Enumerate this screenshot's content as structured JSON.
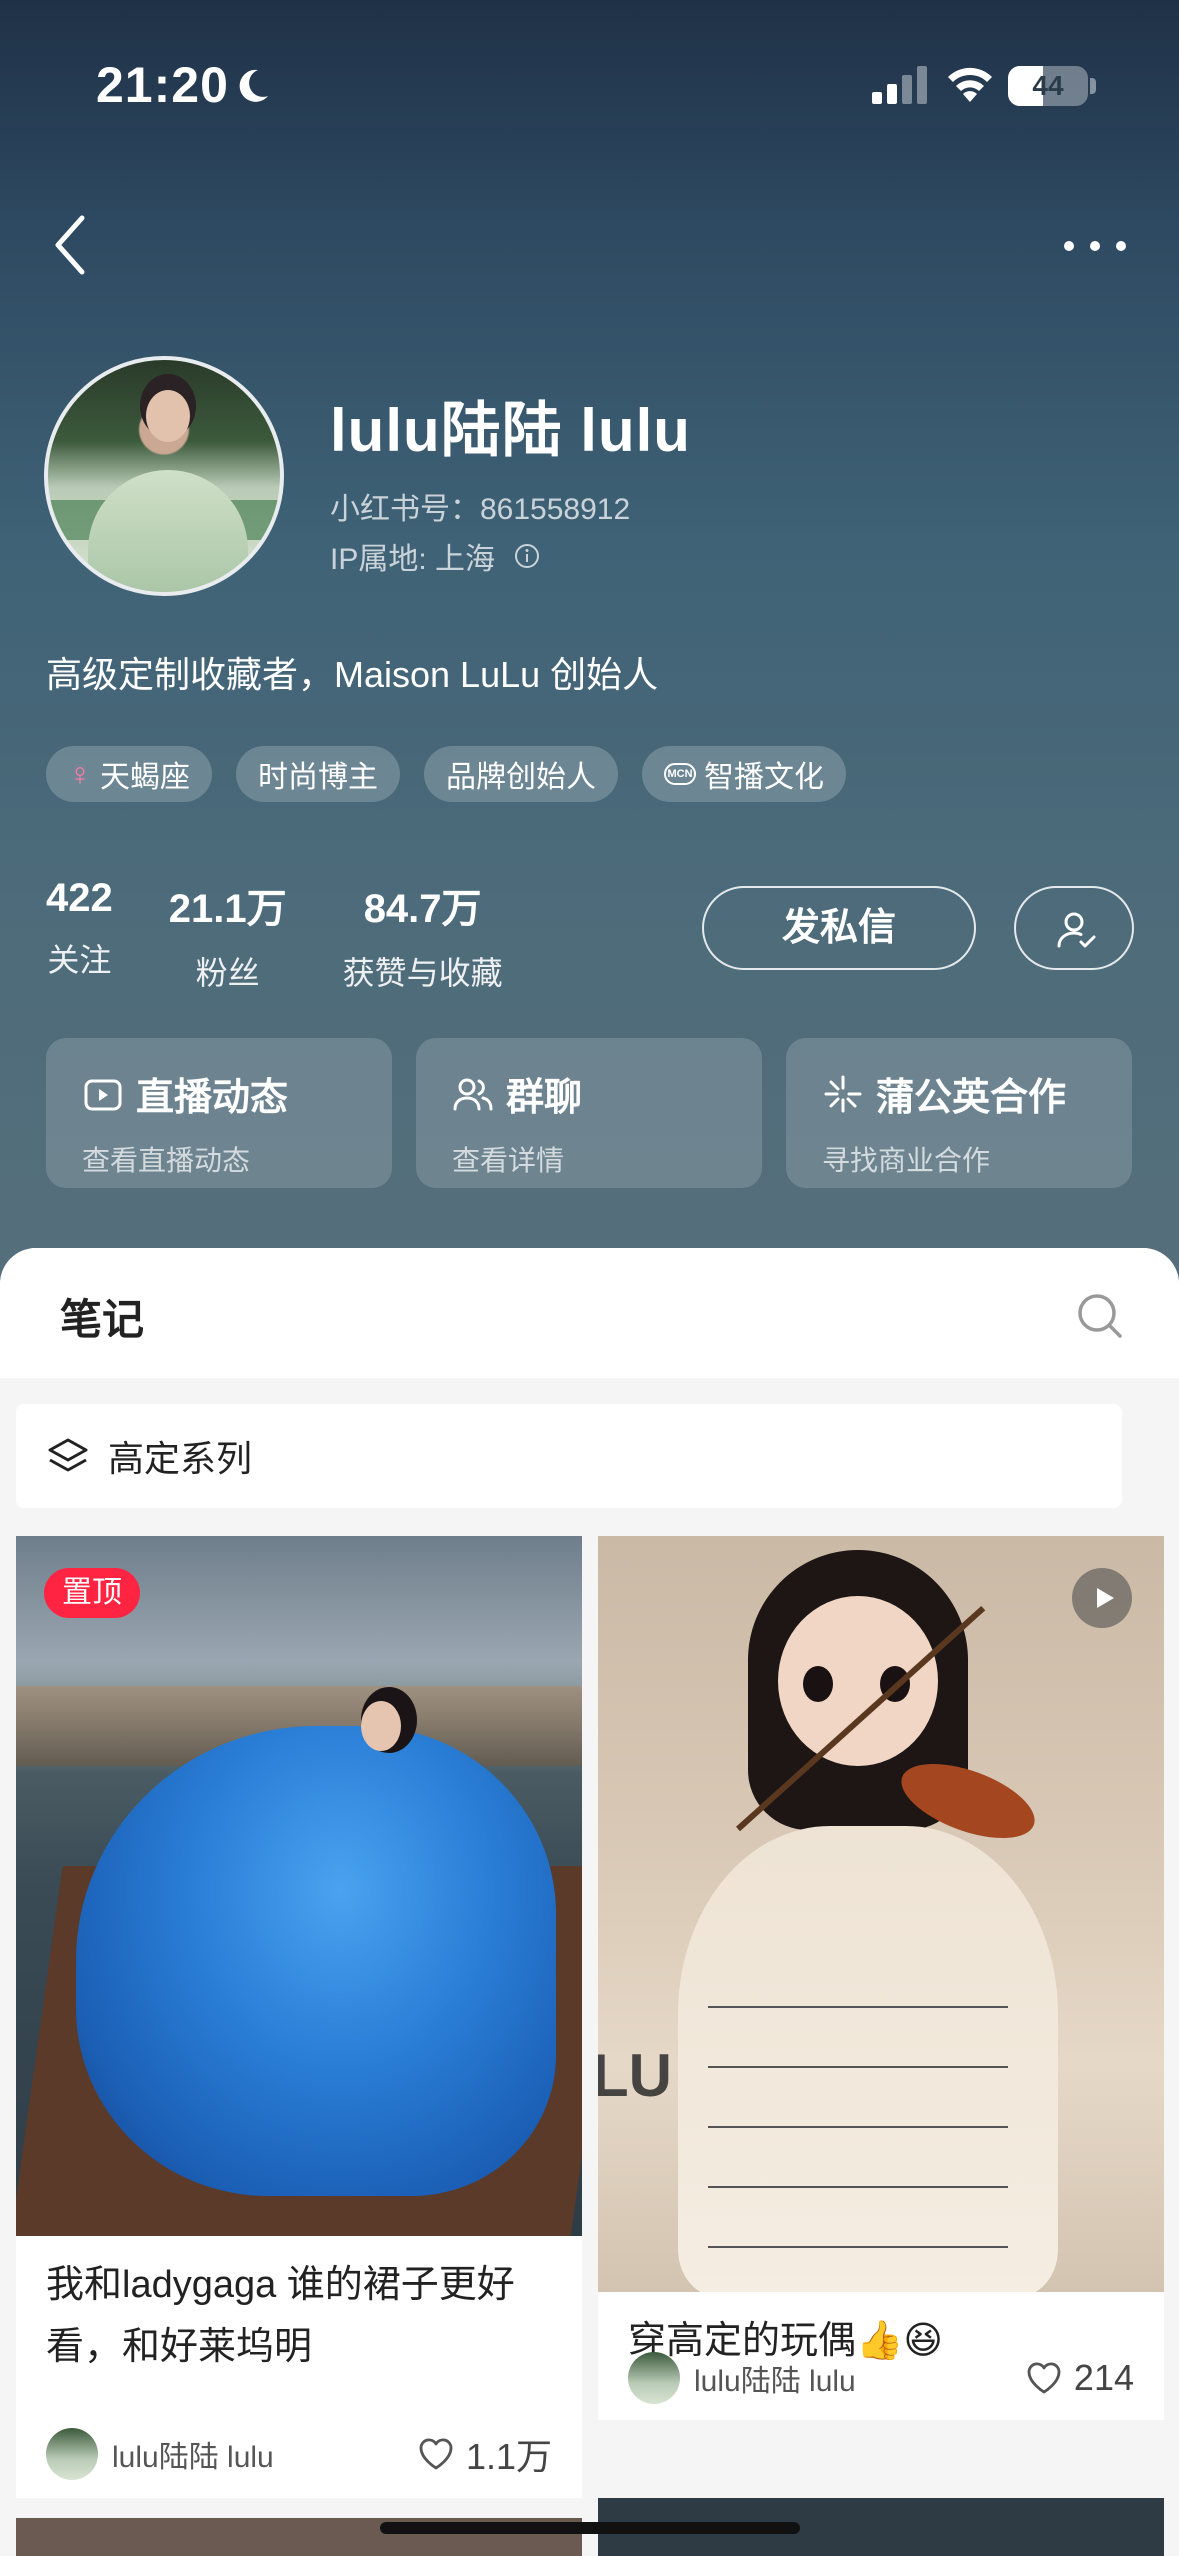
{
  "status": {
    "time": "21:20",
    "battery": "44",
    "battery_level": 0.44
  },
  "profile": {
    "nickname": "lulu陆陆 lulu",
    "red_id": "小红书号：861558912",
    "ip_location": "IP属地: 上海",
    "bio": "高级定制收藏者，Maison LuLu 创始人",
    "tags": [
      {
        "label": "天蝎座",
        "icon": "venus-icon"
      },
      {
        "label": "时尚博主"
      },
      {
        "label": "品牌创始人"
      },
      {
        "label": "智播文化",
        "icon": "mcn-icon"
      }
    ]
  },
  "stats": [
    {
      "value": "422",
      "label": "关注"
    },
    {
      "value": "21.1万",
      "label": "粉丝"
    },
    {
      "value": "84.7万",
      "label": "获赞与收藏"
    }
  ],
  "actions": {
    "message_label": "发私信"
  },
  "cards": [
    {
      "title": "直播动态",
      "subtitle": "查看直播动态",
      "icon": "live-icon"
    },
    {
      "title": "群聊",
      "subtitle": "查看详情",
      "icon": "group-icon"
    },
    {
      "title": "蒲公英合作",
      "subtitle": "寻找商业合作",
      "icon": "dandelion-icon"
    }
  ],
  "tabs": {
    "notes_label": "笔记"
  },
  "collection": {
    "label": "高定系列"
  },
  "notes": [
    {
      "badge": "置顶",
      "title": "我和ladygaga 谁的裙子更好看，和好莱坞明",
      "author": "lulu陆陆 lulu",
      "likes": "1.1万"
    },
    {
      "title": "穿高定的玩偶👍😆",
      "author": "lulu陆陆 lulu",
      "likes": "214"
    }
  ]
}
